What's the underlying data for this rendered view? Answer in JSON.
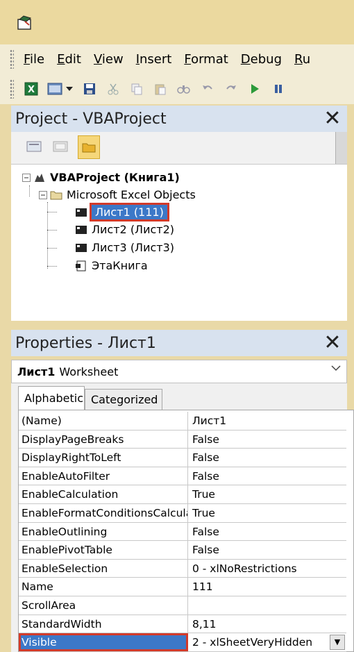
{
  "menu": {
    "items": [
      "File",
      "Edit",
      "View",
      "Insert",
      "Format",
      "Debug",
      "Ru"
    ]
  },
  "toolbar": {
    "icons": [
      "excel-icon",
      "insert-userform-icon",
      "dropdown-icon",
      "save-icon",
      "cut-icon",
      "copy-icon",
      "paste-icon",
      "find-icon",
      "undo-icon",
      "redo-icon",
      "run-icon",
      "break-icon"
    ]
  },
  "project": {
    "title": "Project - VBAProject",
    "close": "✕",
    "tree": {
      "root": "VBAProject (Книга1)",
      "folder": "Microsoft Excel Objects",
      "items": [
        "Лист1 (111)",
        "Лист2 (Лист2)",
        "Лист3 (Лист3)",
        "ЭтаКнига"
      ]
    }
  },
  "properties": {
    "title": "Properties - Лист1",
    "close": "✕",
    "object_name": "Лист1",
    "object_type": "Worksheet",
    "tabs": [
      "Alphabetic",
      "Categorized"
    ],
    "rows": [
      {
        "key": "(Name)",
        "value": "Лист1"
      },
      {
        "key": "DisplayPageBreaks",
        "value": "False"
      },
      {
        "key": "DisplayRightToLeft",
        "value": "False"
      },
      {
        "key": "EnableAutoFilter",
        "value": "False"
      },
      {
        "key": "EnableCalculation",
        "value": "True"
      },
      {
        "key": "EnableFormatConditionsCalculation",
        "value": "True"
      },
      {
        "key": "EnableOutlining",
        "value": "False"
      },
      {
        "key": "EnablePivotTable",
        "value": "False"
      },
      {
        "key": "EnableSelection",
        "value": "0 - xlNoRestrictions"
      },
      {
        "key": "Name",
        "value": "111"
      },
      {
        "key": "ScrollArea",
        "value": ""
      },
      {
        "key": "StandardWidth",
        "value": "8,11"
      },
      {
        "key": "Visible",
        "value": "2 - xlSheetVeryHidden"
      }
    ]
  },
  "colors": {
    "selection": "#3c78c8",
    "highlight_box": "#d23a2a",
    "title_bar": "#ebd99f"
  }
}
